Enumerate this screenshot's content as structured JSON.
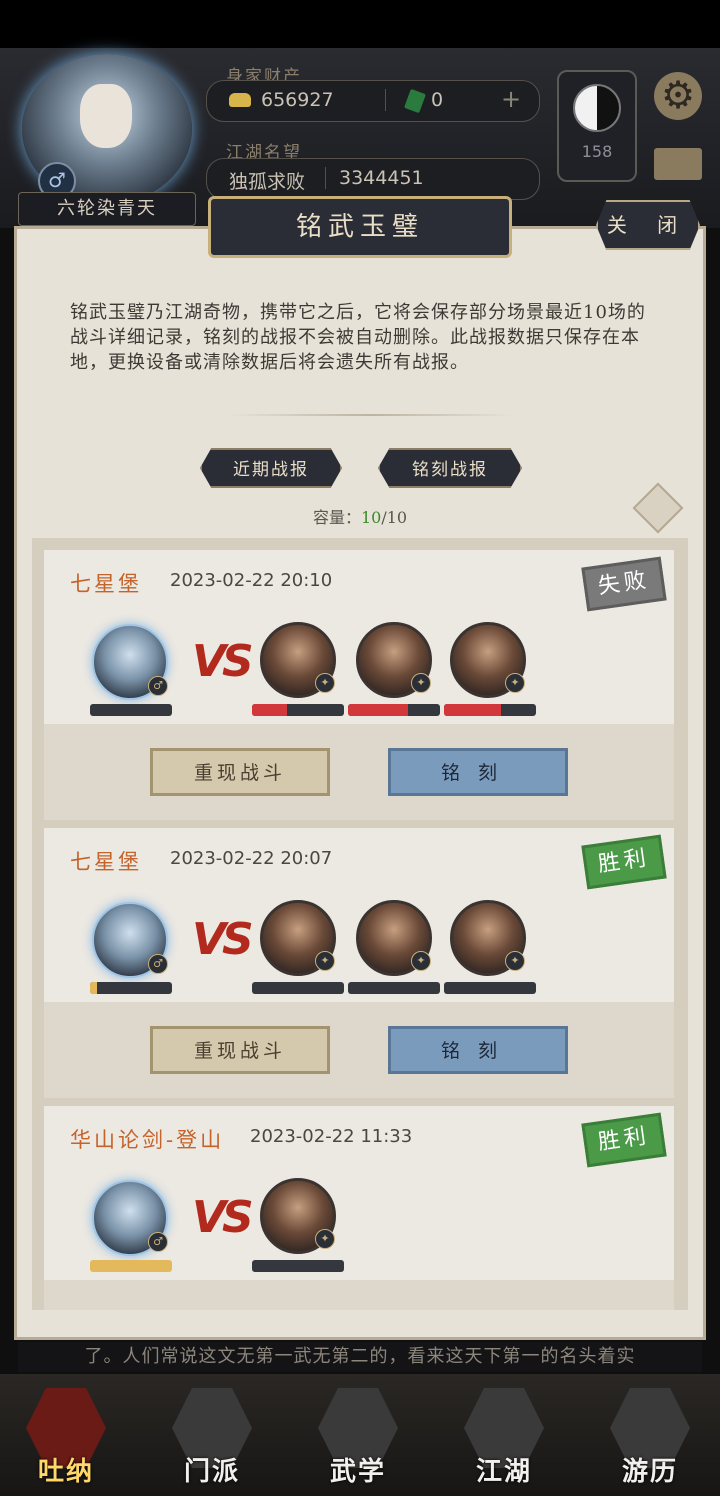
{
  "hud": {
    "player_name": "六轮染青天",
    "gender_icon": "♂",
    "wealth_label": "身家财产",
    "silver": "656927",
    "tickets": "0",
    "add": "+",
    "fame_label": "江湖名望",
    "title": "独孤求败",
    "fame_value": "3344451",
    "level": "158"
  },
  "panel": {
    "title": "铭武玉璧",
    "close_label": "关 闭",
    "description": "铭武玉璧乃江湖奇物，携带它之后，它将会保存部分场景最近10场的战斗详细记录，铭刻的战报不会被自动删除。此战报数据只保存在本地，更换设备或清除数据后将会遗失所有战报。",
    "tabs": [
      "近期战报",
      "铭刻战报"
    ],
    "capacity_label": "容量：",
    "capacity_used": "10",
    "capacity_total": "/10"
  },
  "records": [
    {
      "location": "七星堡",
      "datetime": "2023-02-22  20:10",
      "result": "失败",
      "result_type": "lose",
      "self_hp": 0,
      "enemy_hp": [
        0.38,
        0.65,
        0.62
      ],
      "replay": "重现战斗",
      "engrave": "铭刻"
    },
    {
      "location": "七星堡",
      "datetime": "2023-02-22  20:07",
      "result": "胜利",
      "result_type": "win",
      "self_hp": 0.08,
      "enemy_hp": [
        0,
        0,
        0
      ],
      "replay": "重现战斗",
      "engrave": "铭刻"
    },
    {
      "location": "华山论剑-登山",
      "datetime": "2023-02-22  11:33",
      "result": "胜利",
      "result_type": "win",
      "self_hp": 1,
      "enemy_hp": [
        0
      ]
    }
  ],
  "vs": "VS",
  "ticker": "了。人们常说这文无第一武无第二的，看来这天下第一的名头着实",
  "nav": [
    "吐纳",
    "门派",
    "武学",
    "江湖",
    "游历"
  ],
  "colors": {
    "lose": "#7a7a7a",
    "win": "#4a9a48",
    "accent": "#c4632a"
  }
}
